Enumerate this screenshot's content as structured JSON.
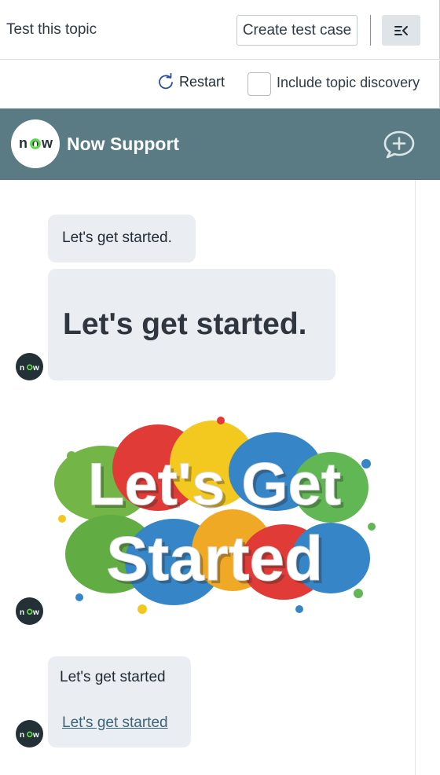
{
  "topbar": {
    "title": "Test this topic",
    "create_label": "Create test case",
    "collapse_icon": "collapse-panel-icon"
  },
  "controls": {
    "restart_label": "Restart",
    "restart_icon": "refresh-icon",
    "discovery_label": "Include topic discovery",
    "discovery_checked": false
  },
  "chat": {
    "brand_logo_text": "now",
    "title": "Now Support",
    "new_chat_icon": "new-conversation-icon",
    "header_color": "#5a7b83",
    "messages": [
      {
        "type": "text",
        "text": "Let's get started."
      },
      {
        "type": "heading",
        "text": "Let's get started."
      },
      {
        "type": "image",
        "image_lines": [
          "Let's Get",
          "Started"
        ]
      },
      {
        "type": "text-link",
        "text": "Let's get started",
        "link_text": "Let's get started"
      }
    ],
    "avatar_text": "now"
  }
}
